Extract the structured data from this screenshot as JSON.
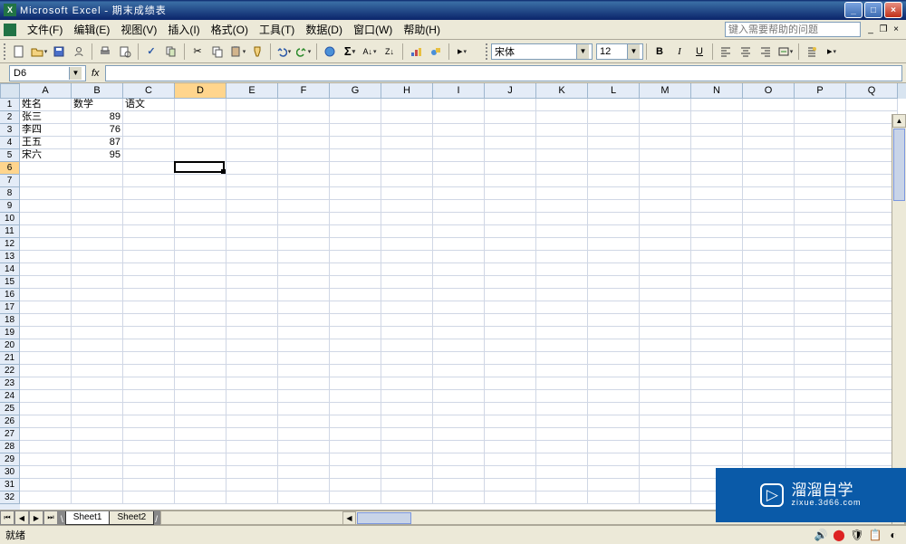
{
  "title": {
    "app": "Microsoft Excel",
    "doc": "期末成绩表"
  },
  "menu": {
    "file": "文件(F)",
    "edit": "编辑(E)",
    "view": "视图(V)",
    "insert": "插入(I)",
    "format": "格式(O)",
    "tools": "工具(T)",
    "data": "数据(D)",
    "window": "窗口(W)",
    "help": "帮助(H)",
    "helpbox": "键入需要帮助的问题"
  },
  "format_toolbar": {
    "font_name": "宋体",
    "font_size": "12"
  },
  "namebox": "D6",
  "columns": [
    "A",
    "B",
    "C",
    "D",
    "E",
    "F",
    "G",
    "H",
    "I",
    "J",
    "K",
    "L",
    "M",
    "N",
    "O",
    "P",
    "Q"
  ],
  "rows": [
    "1",
    "2",
    "3",
    "4",
    "5",
    "6",
    "7",
    "8",
    "9",
    "10",
    "11",
    "12",
    "13",
    "14",
    "15",
    "16",
    "17",
    "18",
    "19",
    "20",
    "21",
    "22",
    "23",
    "24",
    "25",
    "26",
    "27",
    "28",
    "29",
    "30",
    "31",
    "32"
  ],
  "cells": {
    "A1": "姓名",
    "B1": "数学",
    "C1": "语文",
    "A2": "张三",
    "B2": "89",
    "A3": "李四",
    "B3": "76",
    "A4": "王五",
    "B4": "87",
    "A5": "宋六",
    "B5": "95"
  },
  "active_cell": {
    "col": 3,
    "row": 5
  },
  "selected_row": 5,
  "selected_col": 3,
  "sheets": {
    "active": "Sheet1",
    "other": "Sheet2"
  },
  "status": "就绪",
  "watermark": {
    "brand": "溜溜自学",
    "url": "zixue.3d66.com"
  },
  "chart_data": {
    "type": "table",
    "title": "期末成绩表",
    "columns": [
      "姓名",
      "数学",
      "语文"
    ],
    "rows": [
      {
        "姓名": "张三",
        "数学": 89,
        "语文": null
      },
      {
        "姓名": "李四",
        "数学": 76,
        "语文": null
      },
      {
        "姓名": "王五",
        "数学": 87,
        "语文": null
      },
      {
        "姓名": "宋六",
        "数学": 95,
        "语文": null
      }
    ]
  }
}
